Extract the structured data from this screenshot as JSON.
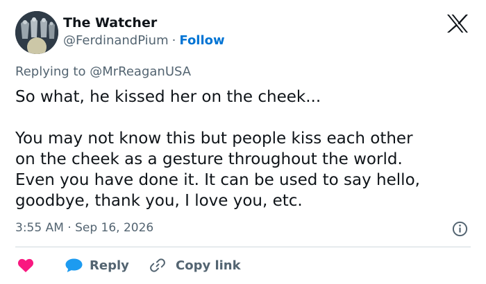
{
  "author": {
    "display_name": "The Watcher",
    "handle": "@FerdinandPium",
    "separator": "·",
    "follow_label": "Follow"
  },
  "reply_to": {
    "prefix": "Replying to",
    "mention": "@MrReaganUSA"
  },
  "body": {
    "line1": "So what, he kissed her on the cheek...",
    "line2": "You may not know this but people kiss each other",
    "line3": "on the cheek as a gesture throughout the world.",
    "line4": "Even you have done it. It can be used to say hello,",
    "line5": "goodbye, thank you, I love you, etc."
  },
  "meta": {
    "timestamp": "3:55 AM · Sep 16, 2026"
  },
  "actions": {
    "reply_label": "Reply",
    "copy_link_label": "Copy link"
  },
  "icons": {
    "brand": "x-logo-icon",
    "info": "info-icon",
    "like": "heart-icon",
    "reply": "speech-bubble-icon",
    "copy": "link-icon"
  },
  "colors": {
    "text": "#0f1419",
    "secondary": "#536471",
    "follow": "#0074d4",
    "heart": "#f91880",
    "reply_bubble": "#1d9bf0",
    "divider": "#cfd9de"
  }
}
